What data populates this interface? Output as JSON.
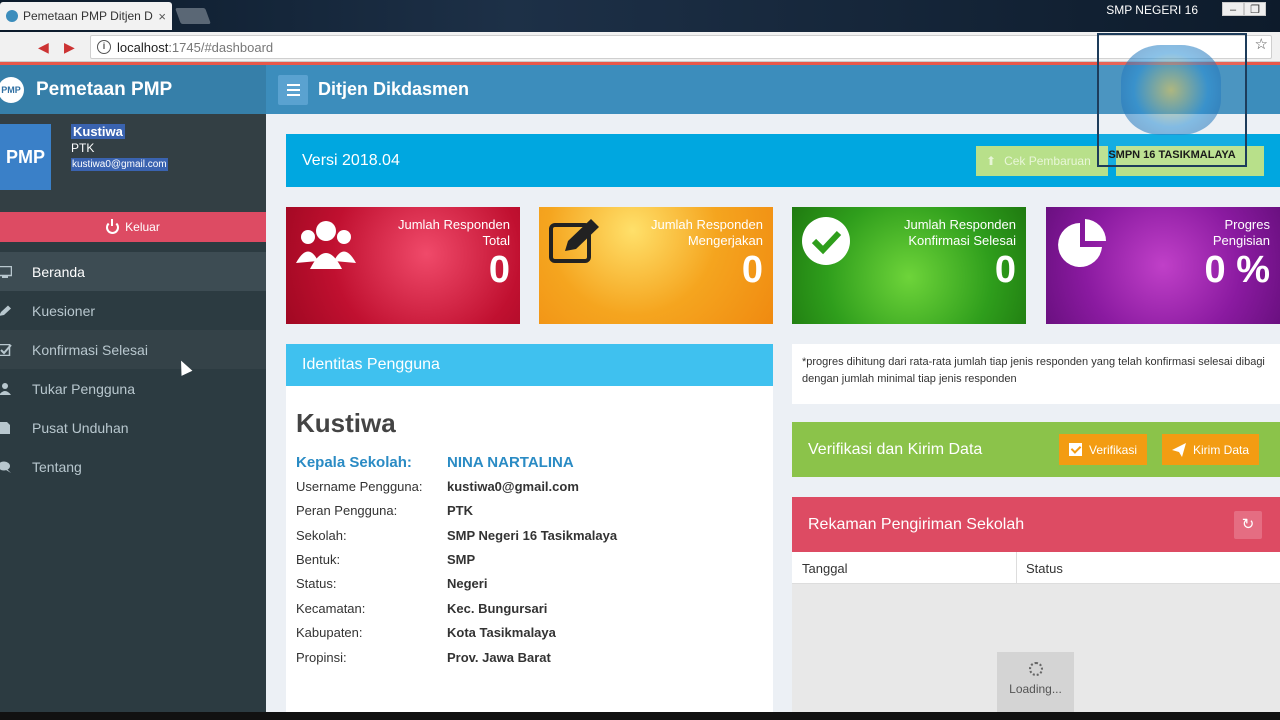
{
  "browser": {
    "tab_title": "Pemetaan PMP Ditjen D",
    "url_host": "localhost",
    "url_path": ":1745/#dashboard",
    "window_title": "SMP NEGERI 16"
  },
  "app": {
    "logo_text": "Pemetaan PMP",
    "logo_mark": "PMP",
    "header_title": "Ditjen Dikdasmen"
  },
  "user": {
    "avatar": "PMP",
    "name": "Kustiwa",
    "role": "PTK",
    "email": "kustiwa0@gmail.com",
    "logout_label": "Keluar"
  },
  "menu": [
    {
      "label": "Beranda",
      "icon": "monitor-icon"
    },
    {
      "label": "Kuesioner",
      "icon": "edit-icon"
    },
    {
      "label": "Konfirmasi Selesai",
      "icon": "check-square-icon"
    },
    {
      "label": "Tukar Pengguna",
      "icon": "users-icon"
    },
    {
      "label": "Pusat Unduhan",
      "icon": "file-icon"
    },
    {
      "label": "Tentang",
      "icon": "chat-icon"
    }
  ],
  "version": {
    "label": "Versi 2018.04",
    "check_button": "Cek Pembaruan"
  },
  "watermark": {
    "text": "SMPN 16 TASIKMALAYA"
  },
  "stats": [
    {
      "label_1": "Jumlah Responden",
      "label_2": "Total",
      "value": "0",
      "icon": "users-icon",
      "color": "#c01030"
    },
    {
      "label_1": "Jumlah Responden",
      "label_2": "Mengerjakan",
      "value": "0",
      "icon": "edit-icon",
      "color": "#f5a51f"
    },
    {
      "label_1": "Jumlah Responden",
      "label_2": "Konfirmasi Selesai",
      "value": "0",
      "icon": "check-circle-icon",
      "color": "#2f9e1c"
    },
    {
      "label_1": "Progres",
      "label_2": "Pengisian",
      "value": "0 %",
      "icon": "pie-chart-icon",
      "color": "#8a1aa0"
    }
  ],
  "identity": {
    "header": "Identitas Pengguna",
    "name": "Kustiwa",
    "kepsek_label": "Kepala Sekolah:",
    "kepsek_value": "NINA NARTALINA",
    "rows": [
      {
        "k": "Username Pengguna:",
        "v": "kustiwa0@gmail.com"
      },
      {
        "k": "Peran Pengguna:",
        "v": "PTK"
      },
      {
        "k": "Sekolah:",
        "v": "SMP Negeri 16 Tasikmalaya"
      },
      {
        "k": "Bentuk:",
        "v": "SMP"
      },
      {
        "k": "Status:",
        "v": "Negeri"
      },
      {
        "k": "Kecamatan:",
        "v": "Kec. Bungursari"
      },
      {
        "k": "Kabupaten:",
        "v": "Kota Tasikmalaya"
      },
      {
        "k": "Propinsi:",
        "v": "Prov. Jawa Barat"
      }
    ]
  },
  "note": "*progres dihitung dari rata-rata jumlah tiap jenis responden yang telah konfirmasi selesai dibagi dengan jumlah minimal tiap jenis responden",
  "verify": {
    "title": "Verifikasi dan Kirim Data",
    "verify_button": "Verifikasi",
    "send_button": "Kirim Data"
  },
  "records": {
    "title": "Rekaman Pengiriman Sekolah",
    "col_date": "Tanggal",
    "col_status": "Status",
    "loading": "Loading..."
  }
}
